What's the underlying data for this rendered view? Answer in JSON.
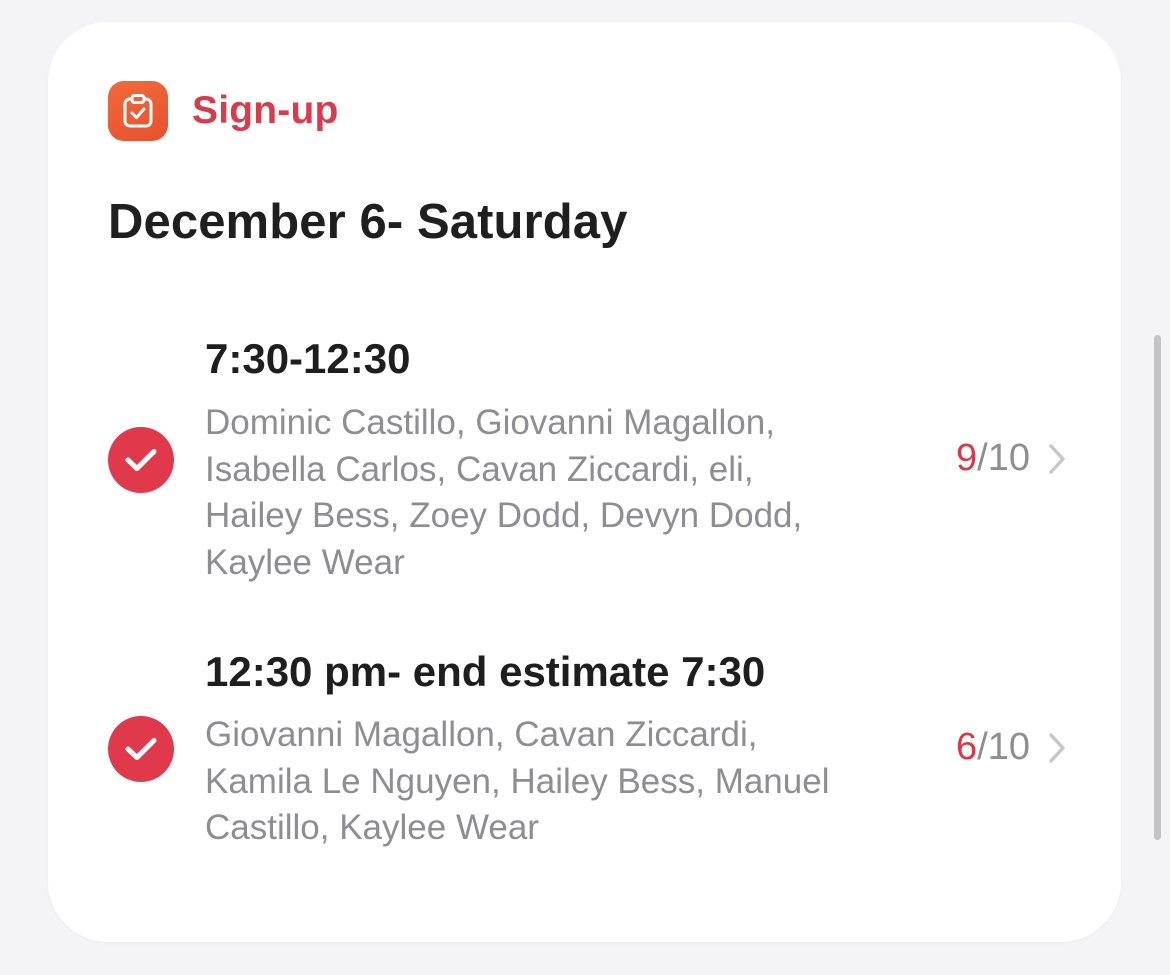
{
  "header": {
    "title": "Sign-up",
    "icon": "clipboard-check-icon",
    "icon_color": "#e8562f",
    "title_color": "#d93b4a"
  },
  "date_title": "December 6- Saturday",
  "slots": [
    {
      "time": "7:30-12:30",
      "names": "Dominic Castillo, Giovanni Magallon, Isabella Carlos, Cavan Ziccardi, eli, Hailey Bess, Zoey Dodd, Devyn Dodd, Kaylee Wear",
      "filled": "9",
      "total": "/10",
      "checked": true
    },
    {
      "time": "12:30 pm- end estimate 7:30",
      "names": "Giovanni Magallon, Cavan Ziccardi, Kamila Le Nguyen, Hailey Bess, Manuel Castillo, Kaylee Wear",
      "filled": "6",
      "total": "/10",
      "checked": true
    }
  ],
  "colors": {
    "accent": "#e0394b",
    "secondary_text": "#8d8d92"
  }
}
